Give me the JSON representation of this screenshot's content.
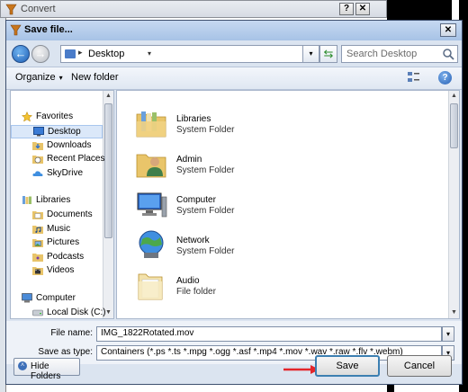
{
  "background_window": {
    "title": "Convert",
    "help_button": "?",
    "close_button": "✕"
  },
  "dialog": {
    "title": "Save file...",
    "close_button": "✕"
  },
  "address_bar": {
    "separator": "▸",
    "location": "Desktop",
    "dropdown_arrow": "▾"
  },
  "search": {
    "placeholder": "Search Desktop"
  },
  "toolbar": {
    "organize": "Organize",
    "organize_arrow": "▾",
    "new_folder": "New folder"
  },
  "navigation": {
    "groups": [
      {
        "label": "Favorites",
        "icon": "star-icon",
        "items": [
          {
            "label": "Desktop",
            "icon": "desktop-icon",
            "selected": true
          },
          {
            "label": "Downloads",
            "icon": "downloads-icon"
          },
          {
            "label": "Recent Places",
            "icon": "recent-places-icon"
          },
          {
            "label": "SkyDrive",
            "icon": "skydrive-icon"
          }
        ]
      },
      {
        "label": "Libraries",
        "icon": "libraries-icon",
        "items": [
          {
            "label": "Documents",
            "icon": "documents-icon"
          },
          {
            "label": "Music",
            "icon": "music-icon"
          },
          {
            "label": "Pictures",
            "icon": "pictures-icon"
          },
          {
            "label": "Podcasts",
            "icon": "podcasts-icon"
          },
          {
            "label": "Videos",
            "icon": "videos-icon"
          }
        ]
      },
      {
        "label": "Computer",
        "icon": "computer-icon",
        "items": [
          {
            "label": "Local Disk (C:)",
            "icon": "disk-icon"
          }
        ]
      }
    ]
  },
  "content_items": [
    {
      "name": "Libraries",
      "type": "System Folder",
      "icon": "libraries-folder-icon"
    },
    {
      "name": "Admin",
      "type": "System Folder",
      "icon": "user-folder-icon"
    },
    {
      "name": "Computer",
      "type": "System Folder",
      "icon": "computer-icon"
    },
    {
      "name": "Network",
      "type": "System Folder",
      "icon": "network-icon"
    },
    {
      "name": "Audio",
      "type": "File folder",
      "icon": "folder-icon"
    }
  ],
  "form": {
    "file_name_label": "File name:",
    "file_name_value": "IMG_1822Rotated.mov",
    "save_type_label": "Save as type:",
    "save_type_value": "Containers (*.ps *.ts *.mpg *.ogg *.asf *.mp4 *.mov *.wav *.raw *.flv *.webm)"
  },
  "footer": {
    "hide_folders": "Hide Folders",
    "hide_folders_chevron": "˄",
    "save": "Save",
    "cancel": "Cancel"
  },
  "colors": {
    "annotation_arrow": "#e3262b",
    "dialog_title_gradient_top": "#c6d9f1",
    "selection": "#dbe8f9"
  }
}
